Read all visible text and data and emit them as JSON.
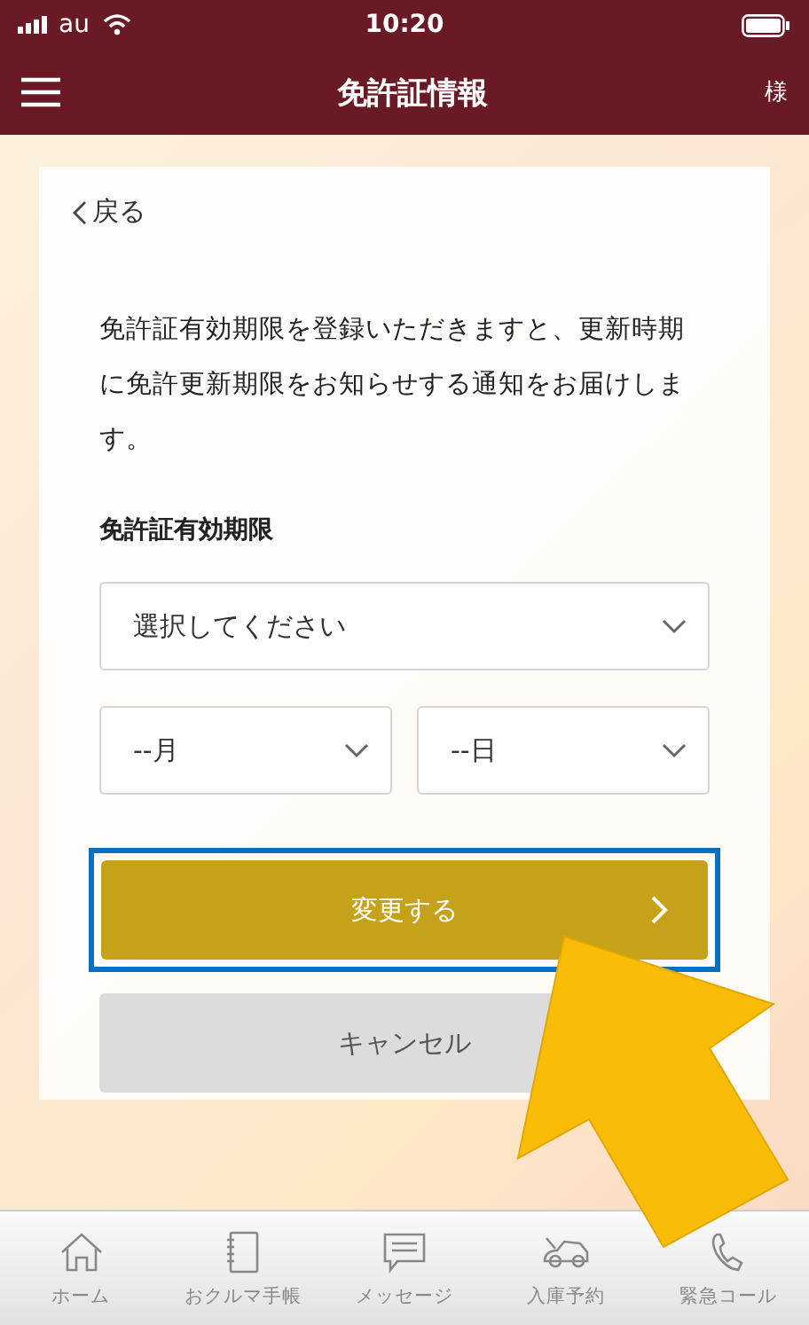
{
  "status_bar": {
    "carrier": "au",
    "time": "10:20"
  },
  "header": {
    "title": "免許証情報",
    "user": "様"
  },
  "back_link": "戻る",
  "description": "免許証有効期限を登録いただきますと、更新時期に免許更新期限をお知らせする通知をお届けします。",
  "expiry_label": "免許証有効期限",
  "year_select": {
    "value": "選択してください"
  },
  "month_select": {
    "value": "--月"
  },
  "day_select": {
    "value": "--日"
  },
  "submit_button": {
    "label": "変更する",
    "highlighted": true
  },
  "cancel_button": {
    "label": "キャンセル"
  },
  "tab_bar": [
    {
      "kind": "home",
      "label": "ホーム",
      "selected": false
    },
    {
      "kind": "notebook",
      "label": "おクルマ手帳",
      "selected": false
    },
    {
      "kind": "message",
      "label": "メッセージ",
      "selected": false
    },
    {
      "kind": "car",
      "label": "入庫予約",
      "selected": false
    },
    {
      "kind": "phone",
      "label": "緊急コール",
      "selected": false
    }
  ]
}
